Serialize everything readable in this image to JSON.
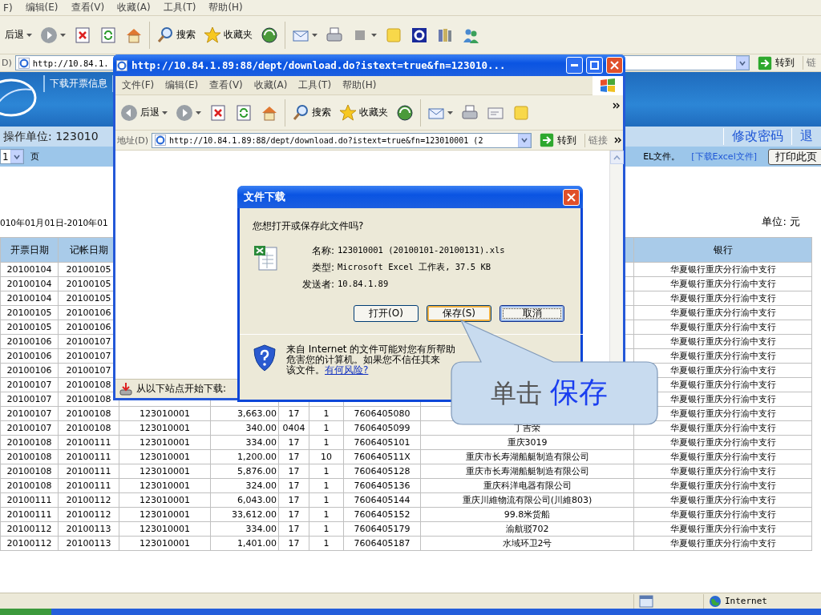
{
  "browser": {
    "menu": [
      "F)",
      "编辑(E)",
      "查看(V)",
      "收藏(A)",
      "工具(T)",
      "帮助(H)"
    ],
    "toolbar": {
      "back": "后退",
      "search": "搜索",
      "favorites": "收藏夹"
    },
    "address": {
      "label": "D)",
      "value": "http://10.84.1.",
      "go": "转到",
      "links": "链"
    }
  },
  "site": {
    "tab": "下载开票信息",
    "unit_label": "操作单位: 123010",
    "links": [
      "修改密码",
      "退"
    ],
    "page_select": "1",
    "page_label": "页",
    "excel_note": "EL文件。",
    "excel_link": "[下载Excel文件]",
    "print_button": "打印此页",
    "date_range": "010年01月01日-2010年01",
    "currency": "单位: 元"
  },
  "table": {
    "columns": [
      "开票日期",
      "记帐日期",
      null,
      null,
      null,
      null,
      null,
      null,
      "银行"
    ],
    "rows": [
      [
        "20100104",
        "20100105",
        null,
        null,
        null,
        null,
        null,
        null,
        "华夏银行重庆分行渝中支行"
      ],
      [
        "20100104",
        "20100105",
        null,
        null,
        null,
        null,
        null,
        null,
        "华夏银行重庆分行渝中支行"
      ],
      [
        "20100104",
        "20100105",
        null,
        null,
        null,
        null,
        null,
        null,
        "华夏银行重庆分行渝中支行"
      ],
      [
        "20100105",
        "20100106",
        null,
        null,
        null,
        null,
        null,
        null,
        "华夏银行重庆分行渝中支行"
      ],
      [
        "20100105",
        "20100106",
        null,
        null,
        null,
        null,
        null,
        null,
        "华夏银行重庆分行渝中支行"
      ],
      [
        "20100106",
        "20100107",
        null,
        null,
        null,
        null,
        null,
        null,
        "华夏银行重庆分行渝中支行"
      ],
      [
        "20100106",
        "20100107",
        null,
        null,
        null,
        null,
        null,
        null,
        "华夏银行重庆分行渝中支行"
      ],
      [
        "20100106",
        "20100107",
        null,
        null,
        null,
        null,
        null,
        null,
        "华夏银行重庆分行渝中支行"
      ],
      [
        "20100107",
        "20100108",
        null,
        null,
        null,
        null,
        null,
        null,
        "华夏银行重庆分行渝中支行"
      ],
      [
        "20100107",
        "20100108",
        null,
        null,
        null,
        null,
        null,
        null,
        "华夏银行重庆分行渝中支行"
      ],
      [
        "20100107",
        "20100108",
        "123010001",
        "3,663.00",
        "17",
        "1",
        "7606405080",
        null,
        "华夏银行重庆分行渝中支行"
      ],
      [
        "20100107",
        "20100108",
        "123010001",
        "340.00",
        "0404",
        "1",
        "7606405099",
        "丁吉荣",
        "华夏银行重庆分行渝中支行"
      ],
      [
        "20100108",
        "20100111",
        "123010001",
        "334.00",
        "17",
        "1",
        "7606405101",
        "重庆3019",
        "华夏银行重庆分行渝中支行"
      ],
      [
        "20100108",
        "20100111",
        "123010001",
        "1,200.00",
        "17",
        "10",
        "760640511X",
        "重庆市长寿湖船艇制造有限公司",
        "华夏银行重庆分行渝中支行"
      ],
      [
        "20100108",
        "20100111",
        "123010001",
        "5,876.00",
        "17",
        "1",
        "7606405128",
        "重庆市长寿湖船艇制造有限公司",
        "华夏银行重庆分行渝中支行"
      ],
      [
        "20100108",
        "20100111",
        "123010001",
        "324.00",
        "17",
        "1",
        "7606405136",
        "重庆科洋电器有限公司",
        "华夏银行重庆分行渝中支行"
      ],
      [
        "20100111",
        "20100112",
        "123010001",
        "6,043.00",
        "17",
        "1",
        "7606405144",
        "重庆川維物流有限公司(川維803)",
        "华夏银行重庆分行渝中支行"
      ],
      [
        "20100111",
        "20100112",
        "123010001",
        "33,612.00",
        "17",
        "1",
        "7606405152",
        "99.8米货船",
        "华夏银行重庆分行渝中支行"
      ],
      [
        "20100112",
        "20100113",
        "123010001",
        "334.00",
        "17",
        "1",
        "7606405179",
        "渝航驳702",
        "华夏银行重庆分行渝中支行"
      ],
      [
        "20100112",
        "20100113",
        "123010001",
        "1,401.00",
        "17",
        "1",
        "7606405187",
        "水域环卫2号",
        "华夏银行重庆分行渝中支行"
      ]
    ]
  },
  "popup": {
    "title": "http://10.84.1.89:88/dept/download.do?istext=true&fn=123010...",
    "menu": [
      "文件(F)",
      "编辑(E)",
      "查看(V)",
      "收藏(A)",
      "工具(T)",
      "帮助(H)"
    ],
    "toolbar": {
      "back": "后退",
      "search": "搜索",
      "favorites": "收藏夹"
    },
    "address": {
      "label": "地址(D)",
      "value": "http://10.84.1.89:88/dept/download.do?istext=true&fn=123010001 (2",
      "go": "转到",
      "links": "链接"
    },
    "status": "从以下站点开始下载:"
  },
  "dialog": {
    "title": "文件下载",
    "question": "您想打开或保存此文件吗?",
    "details": [
      {
        "label": "名称:",
        "value": "123010001 (20100101-20100131).xls"
      },
      {
        "label": "类型:",
        "value": "Microsoft Excel 工作表, 37.5 KB"
      },
      {
        "label": "发送者:",
        "value": "10.84.1.89"
      }
    ],
    "buttons": [
      {
        "label": "打开(O)",
        "hover": false,
        "focused": false
      },
      {
        "label": "保存(S)",
        "hover": true,
        "focused": false
      },
      {
        "label": "取消",
        "hover": false,
        "focused": true
      }
    ],
    "warning": [
      "来自 Internet 的文件可能对您有所帮助",
      "危害您的计算机。如果您不信任其来",
      "该文件。"
    ],
    "warning_link": "有何风险?"
  },
  "callout": {
    "prefix": "单击",
    "emphasis": "保存"
  },
  "status_bar": {
    "zone": "Internet"
  }
}
